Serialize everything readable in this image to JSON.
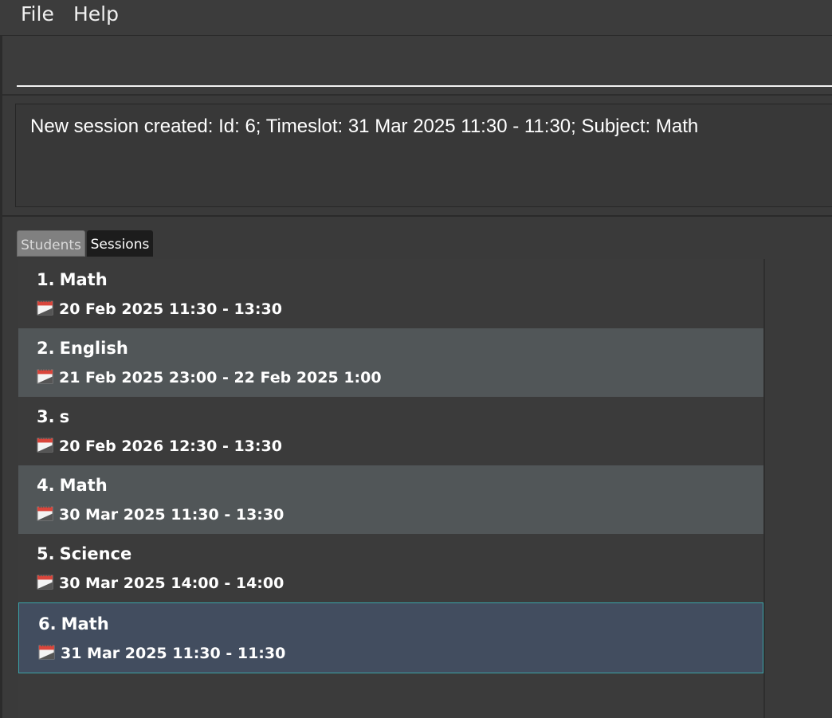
{
  "menu": {
    "file": "File",
    "help": "Help"
  },
  "command": {
    "value": "",
    "placeholder": ""
  },
  "result": {
    "message": "New session created: Id: 6; Timeslot: 31 Mar 2025 11:30 - 11:30; Subject: Math"
  },
  "tabs": [
    {
      "label": "Students",
      "active": false
    },
    {
      "label": "Sessions",
      "active": true
    }
  ],
  "sessions": [
    {
      "index": "1.",
      "subject": "Math",
      "timeslot": "20 Feb 2025 11:30 - 13:30",
      "icon": "calendar-icon"
    },
    {
      "index": "2.",
      "subject": "English",
      "timeslot": "21 Feb 2025 23:00 - 22 Feb 2025 1:00",
      "icon": "calendar-icon"
    },
    {
      "index": "3.",
      "subject": "s",
      "timeslot": "20 Feb 2026 12:30 - 13:30",
      "icon": "calendar-icon"
    },
    {
      "index": "4.",
      "subject": "Math",
      "timeslot": "30 Mar 2025 11:30 - 13:30",
      "icon": "calendar-icon"
    },
    {
      "index": "5.",
      "subject": "Science",
      "timeslot": "30 Mar 2025 14:00 - 14:00",
      "icon": "calendar-icon"
    },
    {
      "index": "6.",
      "subject": "Math",
      "timeslot": "31 Mar 2025 11:30 - 11:30",
      "icon": "calendar-icon",
      "selected": true
    }
  ],
  "colors": {
    "background": "#3a3a3a",
    "row_alt": "#515658",
    "row_selected": "#424d5f",
    "selection_border": "#3aa3a8",
    "tab_active": "#1c1c1c",
    "tab_inactive": "#808080"
  }
}
